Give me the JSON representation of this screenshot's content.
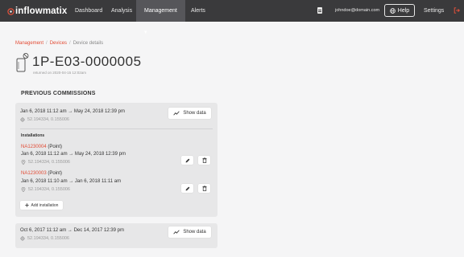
{
  "nav": {
    "logo_text": "inflowmatix",
    "items": [
      {
        "label": "Dashboard"
      },
      {
        "label": "Analysis"
      },
      {
        "label": "Management ▾"
      },
      {
        "label": "Alerts"
      }
    ],
    "user_email": "johndoe@domain.com",
    "help_label": "Help",
    "settings_label": "Settings",
    "icons": [
      "document-icon",
      "globe-icon",
      "logout-icon"
    ]
  },
  "breadcrumb": {
    "items": [
      "Management",
      "Devices",
      "Device details"
    ],
    "separator": "/"
  },
  "device": {
    "id": "1P-E03-0000005",
    "status_text": "returned on 2020-04-15 12:02am"
  },
  "commissions": {
    "title": "PREVIOUS COMMISSIONS",
    "show_data_label": "Show data",
    "items": [
      {
        "date_range": "Jan 6, 2018 11:12 am → May 24, 2018 12:39 pm",
        "coords": "52.194334, 0.155006",
        "installations_title": "Installations",
        "installations": [
          {
            "code": "NA1230004",
            "type": "(Point)",
            "date_range": "Jan 6, 2018 11:12 am → May 24, 2018 12:39 pm",
            "coords": "52.194334, 0.155006"
          },
          {
            "code": "NA1230003",
            "type": "(Point)",
            "date_range": "Jan 6, 2018 11:10 am → Jan 6, 2018 11:11 am",
            "coords": "52.194334, 0.155006"
          }
        ],
        "add_installation_label": "Add installation"
      },
      {
        "date_range": "Oct 6, 2017 11:12 am → Dec 14, 2017 12:39 pm",
        "coords": "52.194334, 0.155006"
      }
    ]
  },
  "colors": {
    "nav_bg": "#3a3a3c",
    "nav_active": "#56565a",
    "accent": "#e24b34",
    "card_bg": "#e7e7e8",
    "page_bg": "#f5f5f6"
  }
}
